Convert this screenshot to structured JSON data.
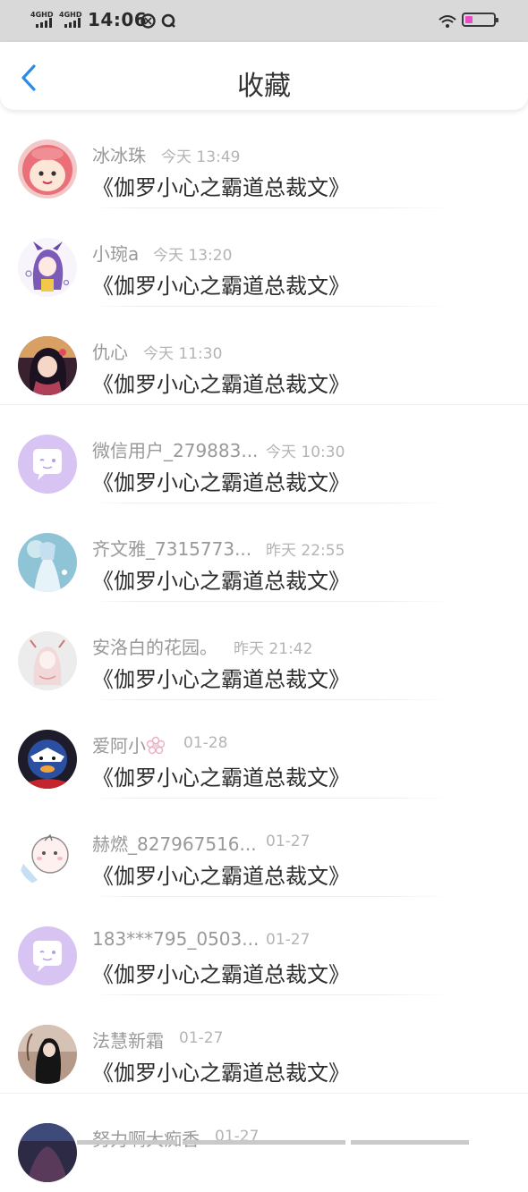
{
  "status_bar": {
    "network_1": "4GHD",
    "network_2": "4GHD",
    "time": "14:06",
    "battery_color": "#e94cc7"
  },
  "header": {
    "title": "收藏",
    "back_icon": "chevron-left-icon",
    "accent": "#2b8ce8"
  },
  "items": [
    {
      "user": "冰冰珠",
      "time": "今天 13:49",
      "title": "《伽罗小心之霸道总裁文》",
      "avatar": "cartoon-girl-helmet"
    },
    {
      "user": "小琬a",
      "time": "今天 13:20",
      "title": "《伽罗小心之霸道总裁文》",
      "avatar": "anime-purple-hair"
    },
    {
      "user": "仇心",
      "time": "今天 11:30",
      "title": "《伽罗小心之霸道总裁文》",
      "avatar": "anime-dark-hair"
    },
    {
      "user": "微信用户_279883...",
      "time": "今天 10:30",
      "title": "《伽罗小心之霸道总裁文》",
      "avatar": "default-chat-bubble"
    },
    {
      "user": "齐文雅_7315773...",
      "time": "昨天 22:55",
      "title": "《伽罗小心之霸道总裁文》",
      "avatar": "anime-blue-dress"
    },
    {
      "user": "安洛白的花园。",
      "time": "昨天 21:42",
      "title": "《伽罗小心之霸道总裁文》",
      "avatar": "anime-sketch-girl"
    },
    {
      "user": "爱阿小",
      "time": "01-28",
      "title": "《伽罗小心之霸道总裁文》",
      "avatar": "cartoon-masked-hero",
      "name_suffix_icon": "flower-icon"
    },
    {
      "user": "赫燃_827967516...",
      "time": "01-27",
      "title": "《伽罗小心之霸道总裁文》",
      "avatar": "cartoon-baby-blue"
    },
    {
      "user": "183***795_0503...",
      "time": "01-27",
      "title": "《伽罗小心之霸道总裁文》",
      "avatar": "default-chat-bubble"
    },
    {
      "user": "法慧新霜",
      "time": "01-27",
      "title": "《伽罗小心之霸道总裁文》",
      "avatar": "anime-dark-figure"
    },
    {
      "user": "努力啊大痴香",
      "time": "01-27",
      "title": "",
      "avatar": "anime-dark-scene"
    }
  ]
}
